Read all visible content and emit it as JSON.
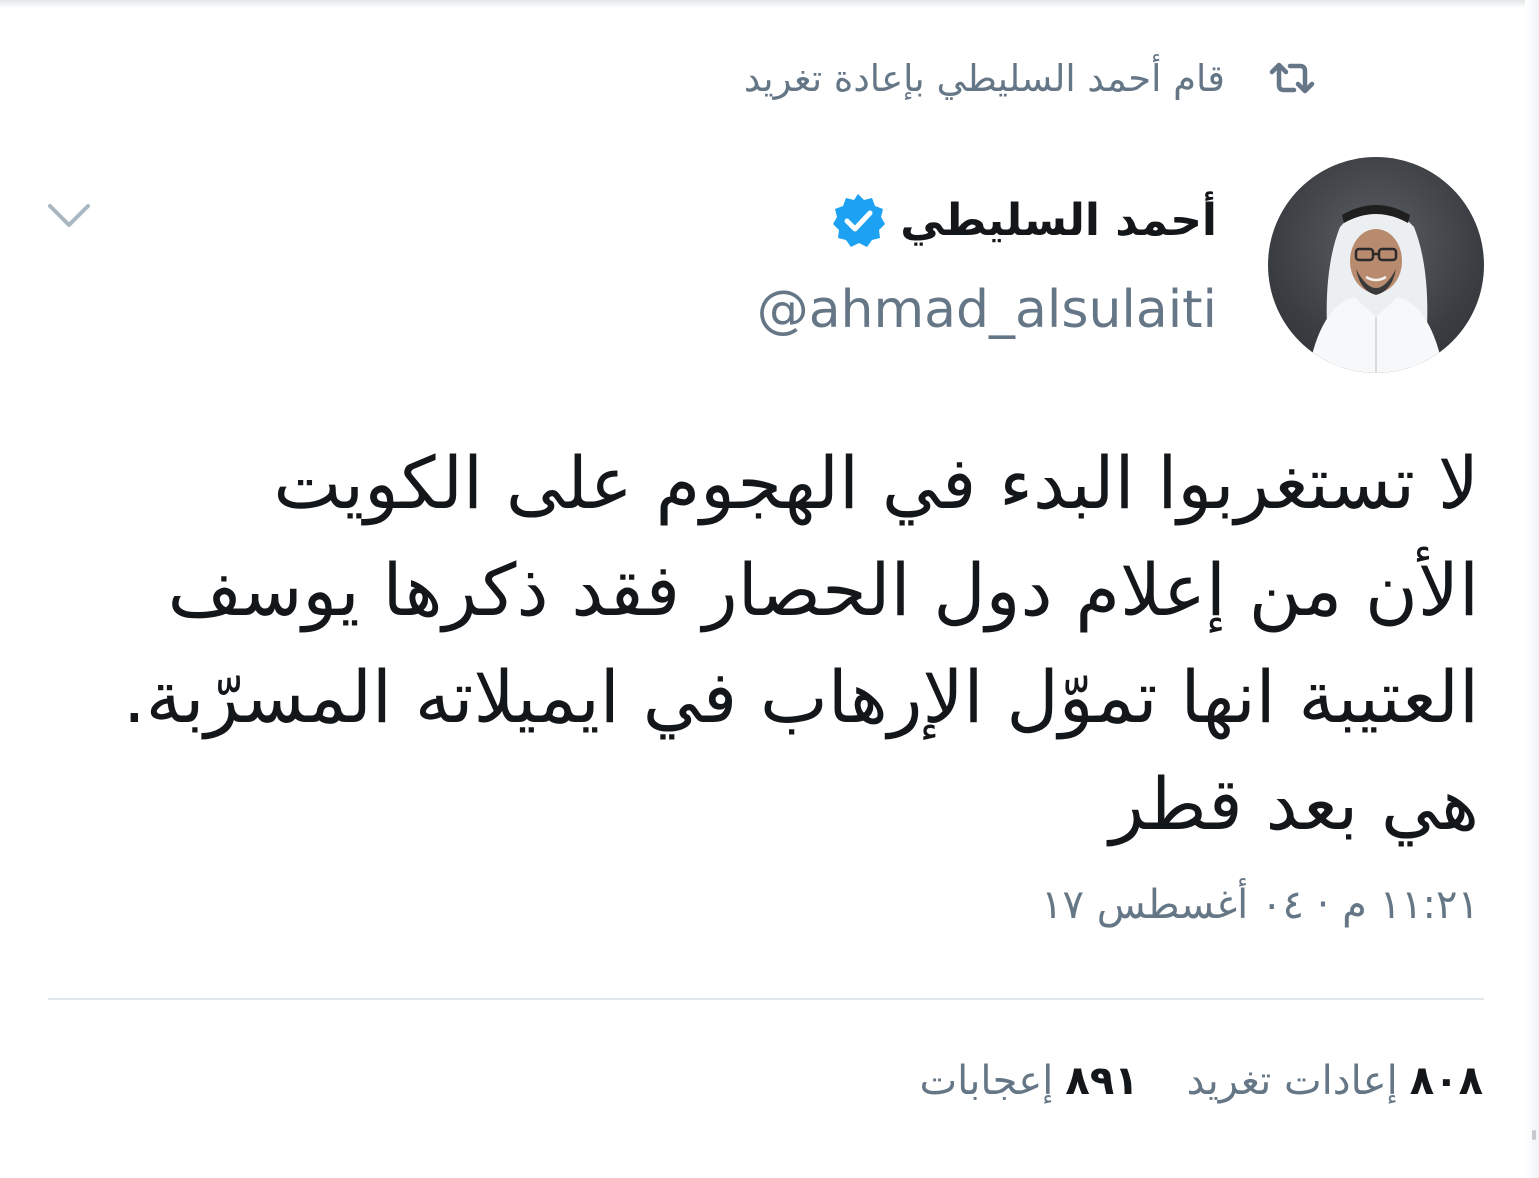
{
  "retweet_banner": {
    "text": "قام أحمد السليطي بإعادة تغريد",
    "icon": "retweet-icon"
  },
  "author": {
    "name": "أحمد السليطي",
    "handle": "@ahmad_alsulaiti",
    "verified_icon": "verified-badge-icon",
    "avatar_icon": "avatar-photo"
  },
  "menu": {
    "icon": "chevron-down-icon"
  },
  "tweet": {
    "lines": [
      "لا تستغربوا البدء في الهجوم على الكويت",
      "الأن من إعلام دول الحصار فقد ذكرها يوسف",
      "العتيبة انها تموّل الإرهاب في ايميلاته المسرّبة.",
      "هي بعد قطر"
    ]
  },
  "timestamp": "١١:٢١ م · ٠٤ أغسطس ١٧",
  "stats": {
    "retweets_count": "٨٠٨",
    "retweets_label": "إعادات تغريد",
    "likes_count": "٨٩١",
    "likes_label": "إعجابات"
  },
  "colors": {
    "text": "#14171a",
    "secondary": "#657786",
    "verified": "#1da1f2",
    "divider": "#e1e8ed"
  }
}
